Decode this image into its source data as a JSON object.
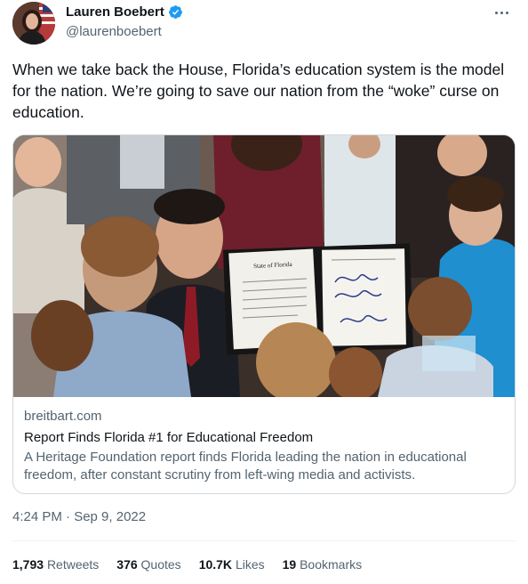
{
  "author": {
    "display_name": "Lauren Boebert",
    "handle": "@laurenboebert",
    "verified": true
  },
  "tweet": {
    "text": "When we take back the House, Florida’s education system is the model for the nation. We’re going to save our nation from the “woke” curse on education.",
    "timestamp": "4:24 PM · Sep 9, 2022"
  },
  "card": {
    "domain": "breitbart.com",
    "title": "Report Finds Florida #1 for Educational Freedom",
    "description": "A Heritage Foundation report finds Florida leading the nation in educational freedom, after constant scrutiny from left-wing media and activists.",
    "document_heading": "State of Florida"
  },
  "stats": [
    {
      "count": "1,793",
      "label": "Retweets"
    },
    {
      "count": "376",
      "label": "Quotes"
    },
    {
      "count": "10.7K",
      "label": "Likes"
    },
    {
      "count": "19",
      "label": "Bookmarks"
    }
  ],
  "colors": {
    "verified": "#1d9bf0",
    "secondary_text": "#536471",
    "border": "#cfd9de"
  },
  "icons": {
    "verified": "verified-badge-icon",
    "more": "more-options-icon"
  }
}
